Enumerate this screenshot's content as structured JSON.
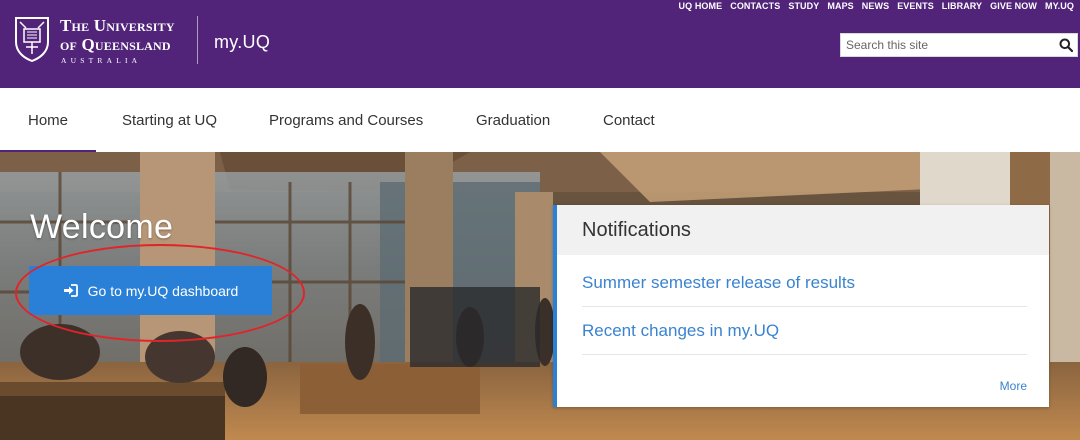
{
  "header": {
    "university_line1": "The University",
    "university_line2": "of Queensland",
    "university_line3": "AUSTRALIA",
    "site_name": "my.UQ",
    "brand_color": "#51247a",
    "util_links": [
      "UQ HOME",
      "CONTACTS",
      "STUDY",
      "MAPS",
      "NEWS",
      "EVENTS",
      "LIBRARY",
      "GIVE NOW",
      "MY.UQ"
    ],
    "search": {
      "placeholder": "Search this site",
      "value": "",
      "icon": "search-icon"
    }
  },
  "nav": {
    "items": [
      {
        "label": "Home",
        "active": true
      },
      {
        "label": "Starting at UQ",
        "active": false
      },
      {
        "label": "Programs and Courses",
        "active": false
      },
      {
        "label": "Graduation",
        "active": false
      },
      {
        "label": "Contact",
        "active": false
      }
    ]
  },
  "hero": {
    "welcome": "Welcome",
    "dashboard_button": {
      "label": "Go to my.UQ dashboard",
      "icon": "sign-in-icon",
      "color": "#2980d6"
    },
    "annotation_color": "#e0242a"
  },
  "notifications": {
    "title": "Notifications",
    "items": [
      "Summer semester release of results",
      "Recent changes in my.UQ"
    ],
    "more_label": "More",
    "link_color": "#3a83cf"
  }
}
